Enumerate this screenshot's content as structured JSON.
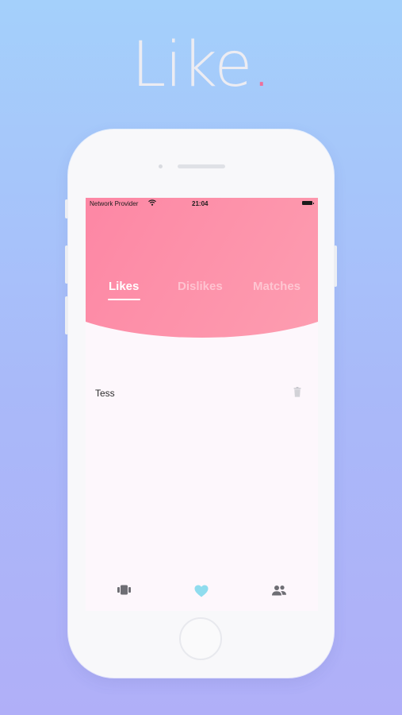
{
  "headline": {
    "word": "Like",
    "dot": "."
  },
  "status_bar": {
    "carrier": "Network Provider",
    "time": "21:04"
  },
  "tabs": [
    {
      "label": "Likes",
      "active": true
    },
    {
      "label": "Dislikes",
      "active": false
    },
    {
      "label": "Matches",
      "active": false
    }
  ],
  "likes_list": [
    {
      "name": "Tess",
      "action_icon": "trash-icon"
    }
  ],
  "bottom_nav": [
    {
      "icon": "cards-icon",
      "active": false
    },
    {
      "icon": "heart-icon",
      "active": true
    },
    {
      "icon": "people-icon",
      "active": false
    }
  ],
  "colors": {
    "accent_pink": "#fd7a9e",
    "dot_pink": "#ee6f9a",
    "active_heart": "#8fdcee",
    "nav_inactive": "#6e6e74"
  }
}
